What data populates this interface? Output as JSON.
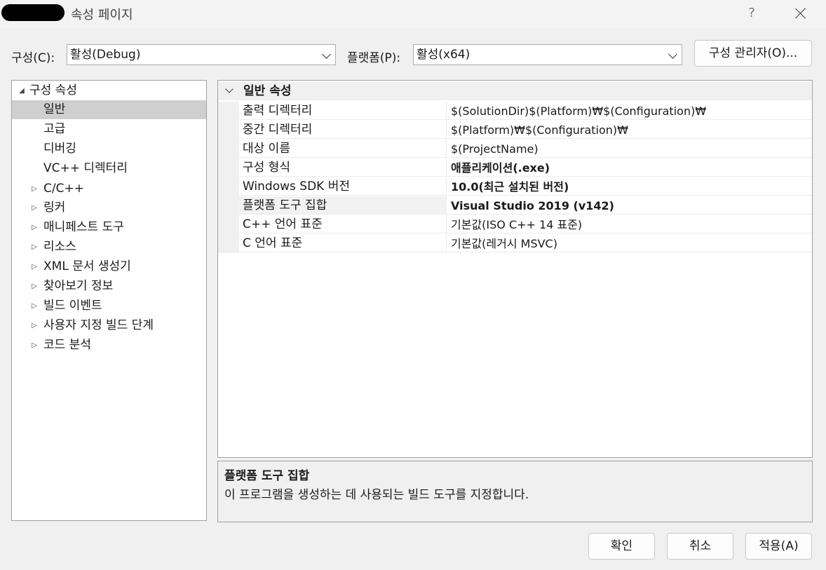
{
  "window": {
    "title": "속성 페이지",
    "help_label": "?"
  },
  "toolbar": {
    "config_label": "구성(C):",
    "config_value": "활성(Debug)",
    "platform_label": "플랫폼(P):",
    "platform_value": "활성(x64)",
    "config_manager_label": "구성 관리자(O)..."
  },
  "tree": {
    "items": [
      {
        "label": "구성 속성",
        "arrow": "◢"
      },
      {
        "label": "일반",
        "arrow": ""
      },
      {
        "label": "고급",
        "arrow": ""
      },
      {
        "label": "디버깅",
        "arrow": ""
      },
      {
        "label": "VC++ 디렉터리",
        "arrow": ""
      },
      {
        "label": "C/C++",
        "arrow": "▷"
      },
      {
        "label": "링커",
        "arrow": "▷"
      },
      {
        "label": "매니페스트 도구",
        "arrow": "▷"
      },
      {
        "label": "리소스",
        "arrow": "▷"
      },
      {
        "label": "XML 문서 생성기",
        "arrow": "▷"
      },
      {
        "label": "찾아보기 정보",
        "arrow": "▷"
      },
      {
        "label": "빌드 이벤트",
        "arrow": "▷"
      },
      {
        "label": "사용자 지정 빌드 단계",
        "arrow": "▷"
      },
      {
        "label": "코드 분석",
        "arrow": "▷"
      }
    ]
  },
  "grid": {
    "section_title": "일반 속성",
    "rows": [
      {
        "name": "출력 디렉터리",
        "value": "$(SolutionDir)$(Platform)₩$(Configuration)₩"
      },
      {
        "name": "중간 디렉터리",
        "value": "$(Platform)₩$(Configuration)₩"
      },
      {
        "name": "대상 이름",
        "value": "$(ProjectName)"
      },
      {
        "name": "구성 형식",
        "value": "애플리케이션(.exe)"
      },
      {
        "name": "Windows SDK 버전",
        "value": "10.0(최근 설치된 버전)"
      },
      {
        "name": "플랫폼 도구 집합",
        "value": "Visual Studio 2019 (v142)"
      },
      {
        "name": "C++ 언어 표준",
        "value": "기본값(ISO C++ 14 표준)"
      },
      {
        "name": "C 언어 표준",
        "value": "기본값(레거시 MSVC)"
      }
    ]
  },
  "description": {
    "title": "플랫폼 도구 집합",
    "text": "이 프로그램을 생성하는 데 사용되는 빌드 도구를 지정합니다."
  },
  "footer": {
    "ok_label": "확인",
    "cancel_label": "취소",
    "apply_label": "적용(A)"
  }
}
